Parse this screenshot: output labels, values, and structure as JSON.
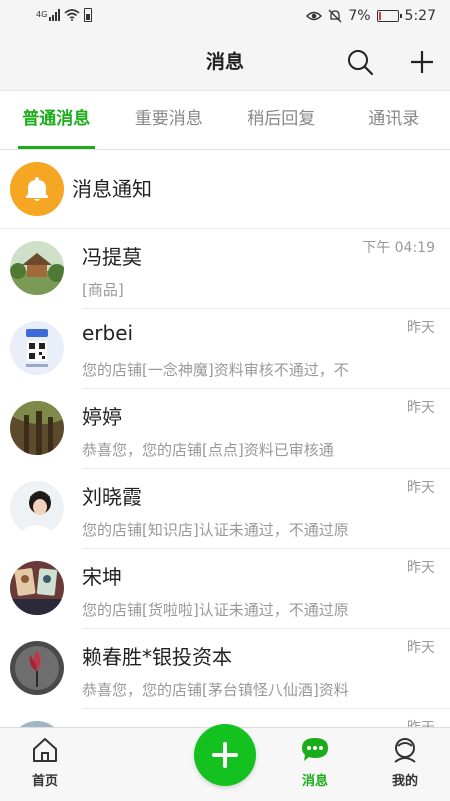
{
  "status_bar": {
    "network": "4G",
    "battery_percent": "7%",
    "time": "5:27"
  },
  "header": {
    "title": "消息",
    "search_icon": "search-icon",
    "add_icon": "plus-icon"
  },
  "tabs": [
    {
      "label": "普通消息",
      "active": true
    },
    {
      "label": "重要消息",
      "active": false
    },
    {
      "label": "稍后回复",
      "active": false
    },
    {
      "label": "通讯录",
      "active": false
    }
  ],
  "notice": {
    "label": "消息通知",
    "icon": "bell-icon",
    "color": "#F5A623"
  },
  "messages": [
    {
      "name": "冯提莫",
      "preview": "[商品]",
      "time": "下午 04:19"
    },
    {
      "name": "erbei",
      "preview": "您的店铺[一念神魔]资料审核不通过，不",
      "time": "昨天"
    },
    {
      "name": "婷婷",
      "preview": "恭喜您，您的店铺[点点]资料已审核通",
      "time": "昨天"
    },
    {
      "name": "刘晓霞",
      "preview": "您的店铺[知识店]认证未通过，不通过原",
      "time": "昨天"
    },
    {
      "name": "宋坤",
      "preview": "您的店铺[货啦啦]认证未通过，不通过原",
      "time": "昨天"
    },
    {
      "name": "赖春胜*银投资本",
      "preview": "恭喜您，您的店铺[茅台镇怪八仙酒]资料",
      "time": "昨天"
    },
    {
      "name": "",
      "preview": "",
      "time": "昨天"
    }
  ],
  "bottom_nav": {
    "home": "首页",
    "messages": "消息",
    "mine": "我的"
  },
  "colors": {
    "accent": "#1AAD19",
    "fab": "#13C21F"
  }
}
